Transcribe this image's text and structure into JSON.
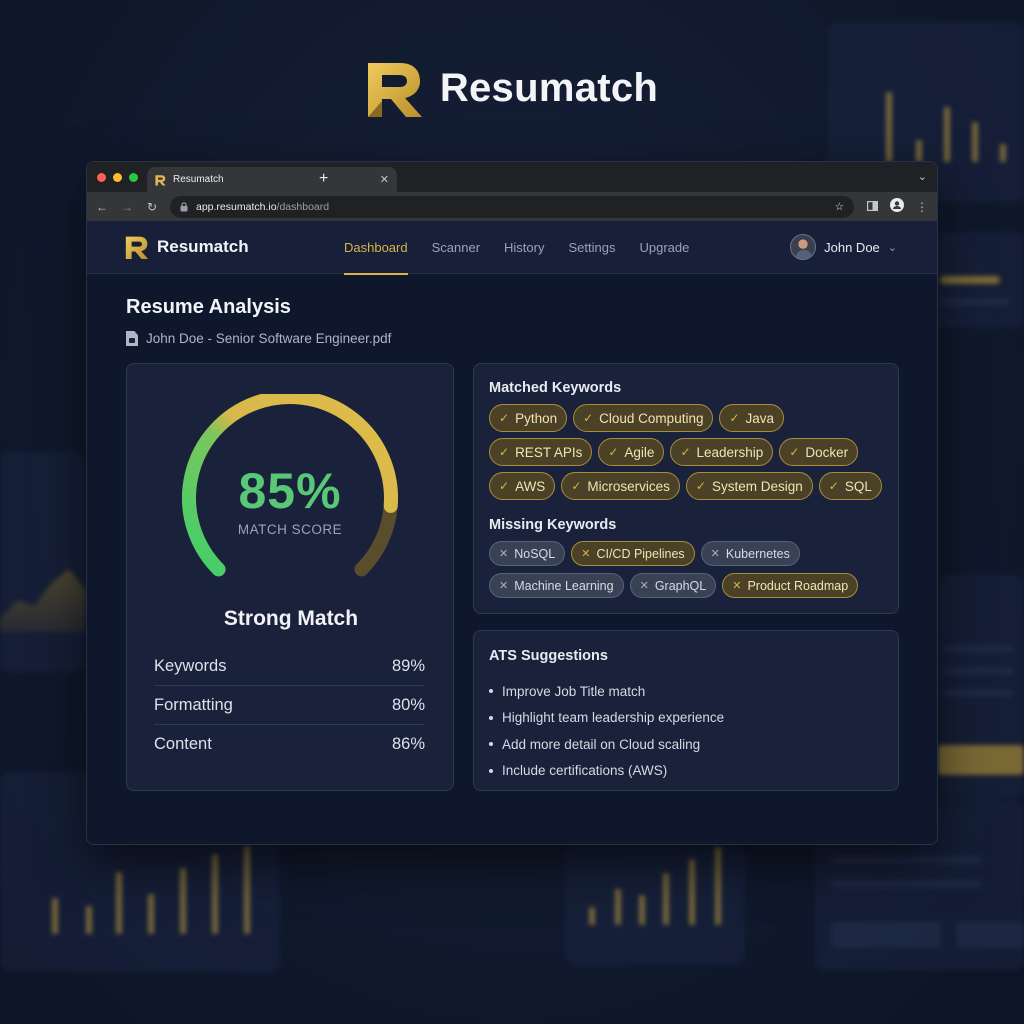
{
  "brand": {
    "name": "Resumatch",
    "accent": "#d9b44a"
  },
  "browser": {
    "tab_title": "Resumatch",
    "url_host": "app.resumatch.io",
    "url_path": "/dashboard"
  },
  "nav": {
    "app_name": "Resumatch",
    "links": [
      {
        "label": "Dashboard",
        "active": true
      },
      {
        "label": "Scanner",
        "active": false
      },
      {
        "label": "History",
        "active": false
      },
      {
        "label": "Settings",
        "active": false
      },
      {
        "label": "Upgrade",
        "active": false
      }
    ],
    "user_name": "John Doe"
  },
  "page": {
    "title": "Resume Analysis",
    "file_name": "John Doe - Senior Software Engineer.pdf"
  },
  "score": {
    "value": "85%",
    "fraction": 0.85,
    "label": "MATCH SCORE",
    "verdict": "Strong Match",
    "metrics": [
      {
        "name": "Keywords",
        "value": "89%"
      },
      {
        "name": "Formatting",
        "value": "80%"
      },
      {
        "name": "Content",
        "value": "86%"
      }
    ]
  },
  "keywords": {
    "matched_title": "Matched Keywords",
    "matched": [
      "Python",
      "Cloud Computing",
      "Java",
      "REST APIs",
      "Agile",
      "Leadership",
      "Docker",
      "AWS",
      "Microservices",
      "System Design",
      "SQL"
    ],
    "missing_title": "Missing Keywords",
    "missing": [
      {
        "label": "NoSQL",
        "style": "gray"
      },
      {
        "label": "CI/CD Pipelines",
        "style": "gold"
      },
      {
        "label": "Kubernetes",
        "style": "gray"
      },
      {
        "label": "Machine Learning",
        "style": "gray"
      },
      {
        "label": "GraphQL",
        "style": "gray"
      },
      {
        "label": "Product Roadmap",
        "style": "gold"
      }
    ]
  },
  "ats": {
    "title": "ATS Suggestions",
    "items": [
      "Improve Job Title match",
      "Highlight team leadership experience",
      "Add more detail on Cloud scaling",
      "Include certifications (AWS)"
    ]
  }
}
